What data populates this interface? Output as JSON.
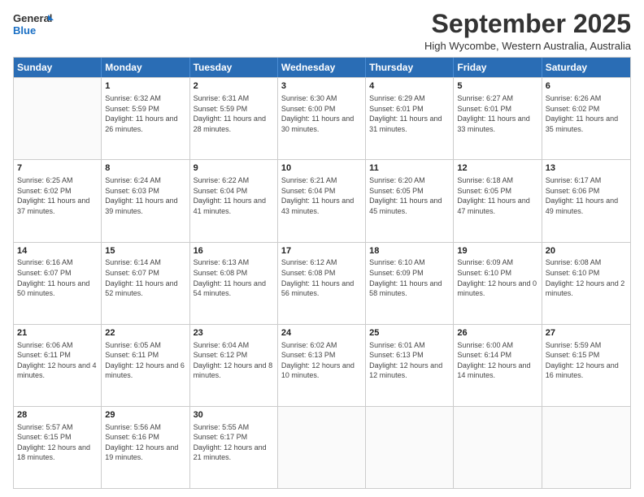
{
  "logo": {
    "general": "General",
    "blue": "Blue"
  },
  "title": "September 2025",
  "location": "High Wycombe, Western Australia, Australia",
  "days_of_week": [
    "Sunday",
    "Monday",
    "Tuesday",
    "Wednesday",
    "Thursday",
    "Friday",
    "Saturday"
  ],
  "weeks": [
    [
      {
        "day": "",
        "sunrise": "",
        "sunset": "",
        "daylight": ""
      },
      {
        "day": "1",
        "sunrise": "Sunrise: 6:32 AM",
        "sunset": "Sunset: 5:59 PM",
        "daylight": "Daylight: 11 hours and 26 minutes."
      },
      {
        "day": "2",
        "sunrise": "Sunrise: 6:31 AM",
        "sunset": "Sunset: 5:59 PM",
        "daylight": "Daylight: 11 hours and 28 minutes."
      },
      {
        "day": "3",
        "sunrise": "Sunrise: 6:30 AM",
        "sunset": "Sunset: 6:00 PM",
        "daylight": "Daylight: 11 hours and 30 minutes."
      },
      {
        "day": "4",
        "sunrise": "Sunrise: 6:29 AM",
        "sunset": "Sunset: 6:01 PM",
        "daylight": "Daylight: 11 hours and 31 minutes."
      },
      {
        "day": "5",
        "sunrise": "Sunrise: 6:27 AM",
        "sunset": "Sunset: 6:01 PM",
        "daylight": "Daylight: 11 hours and 33 minutes."
      },
      {
        "day": "6",
        "sunrise": "Sunrise: 6:26 AM",
        "sunset": "Sunset: 6:02 PM",
        "daylight": "Daylight: 11 hours and 35 minutes."
      }
    ],
    [
      {
        "day": "7",
        "sunrise": "Sunrise: 6:25 AM",
        "sunset": "Sunset: 6:02 PM",
        "daylight": "Daylight: 11 hours and 37 minutes."
      },
      {
        "day": "8",
        "sunrise": "Sunrise: 6:24 AM",
        "sunset": "Sunset: 6:03 PM",
        "daylight": "Daylight: 11 hours and 39 minutes."
      },
      {
        "day": "9",
        "sunrise": "Sunrise: 6:22 AM",
        "sunset": "Sunset: 6:04 PM",
        "daylight": "Daylight: 11 hours and 41 minutes."
      },
      {
        "day": "10",
        "sunrise": "Sunrise: 6:21 AM",
        "sunset": "Sunset: 6:04 PM",
        "daylight": "Daylight: 11 hours and 43 minutes."
      },
      {
        "day": "11",
        "sunrise": "Sunrise: 6:20 AM",
        "sunset": "Sunset: 6:05 PM",
        "daylight": "Daylight: 11 hours and 45 minutes."
      },
      {
        "day": "12",
        "sunrise": "Sunrise: 6:18 AM",
        "sunset": "Sunset: 6:05 PM",
        "daylight": "Daylight: 11 hours and 47 minutes."
      },
      {
        "day": "13",
        "sunrise": "Sunrise: 6:17 AM",
        "sunset": "Sunset: 6:06 PM",
        "daylight": "Daylight: 11 hours and 49 minutes."
      }
    ],
    [
      {
        "day": "14",
        "sunrise": "Sunrise: 6:16 AM",
        "sunset": "Sunset: 6:07 PM",
        "daylight": "Daylight: 11 hours and 50 minutes."
      },
      {
        "day": "15",
        "sunrise": "Sunrise: 6:14 AM",
        "sunset": "Sunset: 6:07 PM",
        "daylight": "Daylight: 11 hours and 52 minutes."
      },
      {
        "day": "16",
        "sunrise": "Sunrise: 6:13 AM",
        "sunset": "Sunset: 6:08 PM",
        "daylight": "Daylight: 11 hours and 54 minutes."
      },
      {
        "day": "17",
        "sunrise": "Sunrise: 6:12 AM",
        "sunset": "Sunset: 6:08 PM",
        "daylight": "Daylight: 11 hours and 56 minutes."
      },
      {
        "day": "18",
        "sunrise": "Sunrise: 6:10 AM",
        "sunset": "Sunset: 6:09 PM",
        "daylight": "Daylight: 11 hours and 58 minutes."
      },
      {
        "day": "19",
        "sunrise": "Sunrise: 6:09 AM",
        "sunset": "Sunset: 6:10 PM",
        "daylight": "Daylight: 12 hours and 0 minutes."
      },
      {
        "day": "20",
        "sunrise": "Sunrise: 6:08 AM",
        "sunset": "Sunset: 6:10 PM",
        "daylight": "Daylight: 12 hours and 2 minutes."
      }
    ],
    [
      {
        "day": "21",
        "sunrise": "Sunrise: 6:06 AM",
        "sunset": "Sunset: 6:11 PM",
        "daylight": "Daylight: 12 hours and 4 minutes."
      },
      {
        "day": "22",
        "sunrise": "Sunrise: 6:05 AM",
        "sunset": "Sunset: 6:11 PM",
        "daylight": "Daylight: 12 hours and 6 minutes."
      },
      {
        "day": "23",
        "sunrise": "Sunrise: 6:04 AM",
        "sunset": "Sunset: 6:12 PM",
        "daylight": "Daylight: 12 hours and 8 minutes."
      },
      {
        "day": "24",
        "sunrise": "Sunrise: 6:02 AM",
        "sunset": "Sunset: 6:13 PM",
        "daylight": "Daylight: 12 hours and 10 minutes."
      },
      {
        "day": "25",
        "sunrise": "Sunrise: 6:01 AM",
        "sunset": "Sunset: 6:13 PM",
        "daylight": "Daylight: 12 hours and 12 minutes."
      },
      {
        "day": "26",
        "sunrise": "Sunrise: 6:00 AM",
        "sunset": "Sunset: 6:14 PM",
        "daylight": "Daylight: 12 hours and 14 minutes."
      },
      {
        "day": "27",
        "sunrise": "Sunrise: 5:59 AM",
        "sunset": "Sunset: 6:15 PM",
        "daylight": "Daylight: 12 hours and 16 minutes."
      }
    ],
    [
      {
        "day": "28",
        "sunrise": "Sunrise: 5:57 AM",
        "sunset": "Sunset: 6:15 PM",
        "daylight": "Daylight: 12 hours and 18 minutes."
      },
      {
        "day": "29",
        "sunrise": "Sunrise: 5:56 AM",
        "sunset": "Sunset: 6:16 PM",
        "daylight": "Daylight: 12 hours and 19 minutes."
      },
      {
        "day": "30",
        "sunrise": "Sunrise: 5:55 AM",
        "sunset": "Sunset: 6:17 PM",
        "daylight": "Daylight: 12 hours and 21 minutes."
      },
      {
        "day": "",
        "sunrise": "",
        "sunset": "",
        "daylight": ""
      },
      {
        "day": "",
        "sunrise": "",
        "sunset": "",
        "daylight": ""
      },
      {
        "day": "",
        "sunrise": "",
        "sunset": "",
        "daylight": ""
      },
      {
        "day": "",
        "sunrise": "",
        "sunset": "",
        "daylight": ""
      }
    ]
  ]
}
